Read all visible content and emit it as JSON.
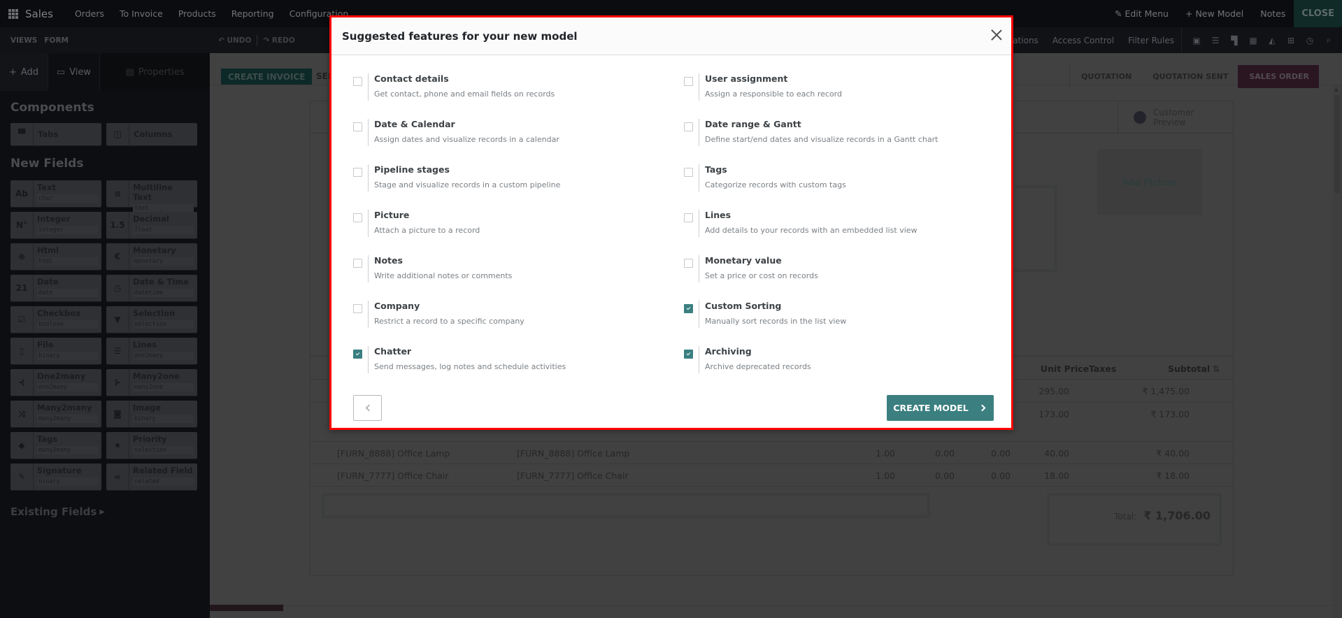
{
  "topbar": {
    "brand": "Sales",
    "menu": [
      "Orders",
      "To Invoice",
      "Products",
      "Reporting",
      "Configuration"
    ],
    "right": {
      "edit_menu": "Edit Menu",
      "new_model": "New Model",
      "notes": "Notes",
      "close": "CLOSE"
    }
  },
  "subbar": {
    "breadcrumb": [
      "VIEWS",
      "FORM"
    ],
    "undo": "UNDO",
    "redo": "REDO",
    "right_links": [
      "Automations",
      "Access Control",
      "Filter Rules"
    ],
    "view_icons": [
      "form-view-icon",
      "list-view-icon",
      "kanban-view-icon",
      "calendar-view-icon",
      "graph-view-icon",
      "pivot-view-icon",
      "activity-view-icon",
      "search-view-icon"
    ]
  },
  "sidebar": {
    "tabs": [
      {
        "label": "Add",
        "icon": "plus-icon"
      },
      {
        "label": "View",
        "icon": "monitor-icon"
      },
      {
        "label": "Properties",
        "icon": "server-icon"
      }
    ],
    "components_title": "Components",
    "components": [
      {
        "label": "Tabs",
        "icon": "tabs-icon"
      },
      {
        "label": "Columns",
        "icon": "columns-icon"
      }
    ],
    "new_fields_title": "New Fields",
    "fields": [
      {
        "label": "Text",
        "tech": "char",
        "icon": "Ab"
      },
      {
        "label": "Multiline Text",
        "tech": "text",
        "icon": "≡"
      },
      {
        "label": "Integer",
        "tech": "integer",
        "icon": "N°"
      },
      {
        "label": "Decimal",
        "tech": "float",
        "icon": "1.5"
      },
      {
        "label": "Html",
        "tech": "html",
        "icon": "⊕"
      },
      {
        "label": "Monetary",
        "tech": "monetary",
        "icon": "€"
      },
      {
        "label": "Date",
        "tech": "date",
        "icon": "21"
      },
      {
        "label": "Date & Time",
        "tech": "datetime",
        "icon": "◷"
      },
      {
        "label": "Checkbox",
        "tech": "boolean",
        "icon": "☑"
      },
      {
        "label": "Selection",
        "tech": "selection",
        "icon": "▼"
      },
      {
        "label": "File",
        "tech": "binary",
        "icon": "▯"
      },
      {
        "label": "Lines",
        "tech": "one2many",
        "icon": "☰"
      },
      {
        "label": "One2many",
        "tech": "one2many",
        "icon": "⊰"
      },
      {
        "label": "Many2one",
        "tech": "many2one",
        "icon": "⊱"
      },
      {
        "label": "Many2many",
        "tech": "many2many",
        "icon": "⤨"
      },
      {
        "label": "Image",
        "tech": "binary",
        "icon": "◙"
      },
      {
        "label": "Tags",
        "tech": "many2many",
        "icon": "◆"
      },
      {
        "label": "Priority",
        "tech": "selection",
        "icon": "★"
      },
      {
        "label": "Signature",
        "tech": "binary",
        "icon": "✎"
      },
      {
        "label": "Related Field",
        "tech": "related",
        "icon": "∞"
      }
    ],
    "existing_fields": "Existing Fields"
  },
  "form": {
    "create_invoice": "CREATE INVOICE",
    "send": "SEND",
    "stages": [
      "QUOTATION",
      "QUOTATION SENT",
      "SALES ORDER"
    ],
    "active_stage": "SALES ORDER",
    "customer_preview": [
      "Customer",
      "Preview"
    ],
    "add_picture": "Add Picture",
    "lines_headers": {
      "unit_price": "Unit Price",
      "taxes": "Taxes",
      "subtotal": "Subtotal"
    },
    "lines": [
      {
        "product": "",
        "description": "",
        "qty": "",
        "disc1": "",
        "disc2": "",
        "unit_price": "295.00",
        "subtotal": "₹ 1,475.00"
      },
      {
        "product": "",
        "description": "",
        "qty": "",
        "disc1": "",
        "disc2": "",
        "unit_price": "173.00",
        "subtotal": "₹ 173.00"
      },
      {
        "product": "[FURN_8888] Office Lamp",
        "description": "[FURN_8888] Office Lamp",
        "qty": "1.00",
        "disc1": "0.00",
        "disc2": "0.00",
        "unit_price": "40.00",
        "subtotal": "₹ 40.00"
      },
      {
        "product": "[FURN_7777] Office Chair",
        "description": "[FURN_7777] Office Chair",
        "qty": "1.00",
        "disc1": "0.00",
        "disc2": "0.00",
        "unit_price": "18.00",
        "subtotal": "₹ 18.00"
      }
    ],
    "total_label": "Total:",
    "total_value": "₹ 1,706.00"
  },
  "modal": {
    "title": "Suggested features for your new model",
    "features": [
      {
        "name": "Contact details",
        "desc": "Get contact, phone and email fields on records",
        "checked": false
      },
      {
        "name": "User assignment",
        "desc": "Assign a responsible to each record",
        "checked": false
      },
      {
        "name": "Date & Calendar",
        "desc": "Assign dates and visualize records in a calendar",
        "checked": false
      },
      {
        "name": "Date range & Gantt",
        "desc": "Define start/end dates and visualize records in a Gantt chart",
        "checked": false
      },
      {
        "name": "Pipeline stages",
        "desc": "Stage and visualize records in a custom pipeline",
        "checked": false
      },
      {
        "name": "Tags",
        "desc": "Categorize records with custom tags",
        "checked": false
      },
      {
        "name": "Picture",
        "desc": "Attach a picture to a record",
        "checked": false
      },
      {
        "name": "Lines",
        "desc": "Add details to your records with an embedded list view",
        "checked": false
      },
      {
        "name": "Notes",
        "desc": "Write additional notes or comments",
        "checked": false
      },
      {
        "name": "Monetary value",
        "desc": "Set a price or cost on records",
        "checked": false
      },
      {
        "name": "Company",
        "desc": "Restrict a record to a specific company",
        "checked": false
      },
      {
        "name": "Custom Sorting",
        "desc": "Manually sort records in the list view",
        "checked": true
      },
      {
        "name": "Chatter",
        "desc": "Send messages, log notes and schedule activities",
        "checked": true
      },
      {
        "name": "Archiving",
        "desc": "Archive deprecated records",
        "checked": true
      }
    ],
    "create_label": "CREATE MODEL",
    "accent_color": "#3b7f80",
    "highlight_border_color": "#ff0000"
  }
}
